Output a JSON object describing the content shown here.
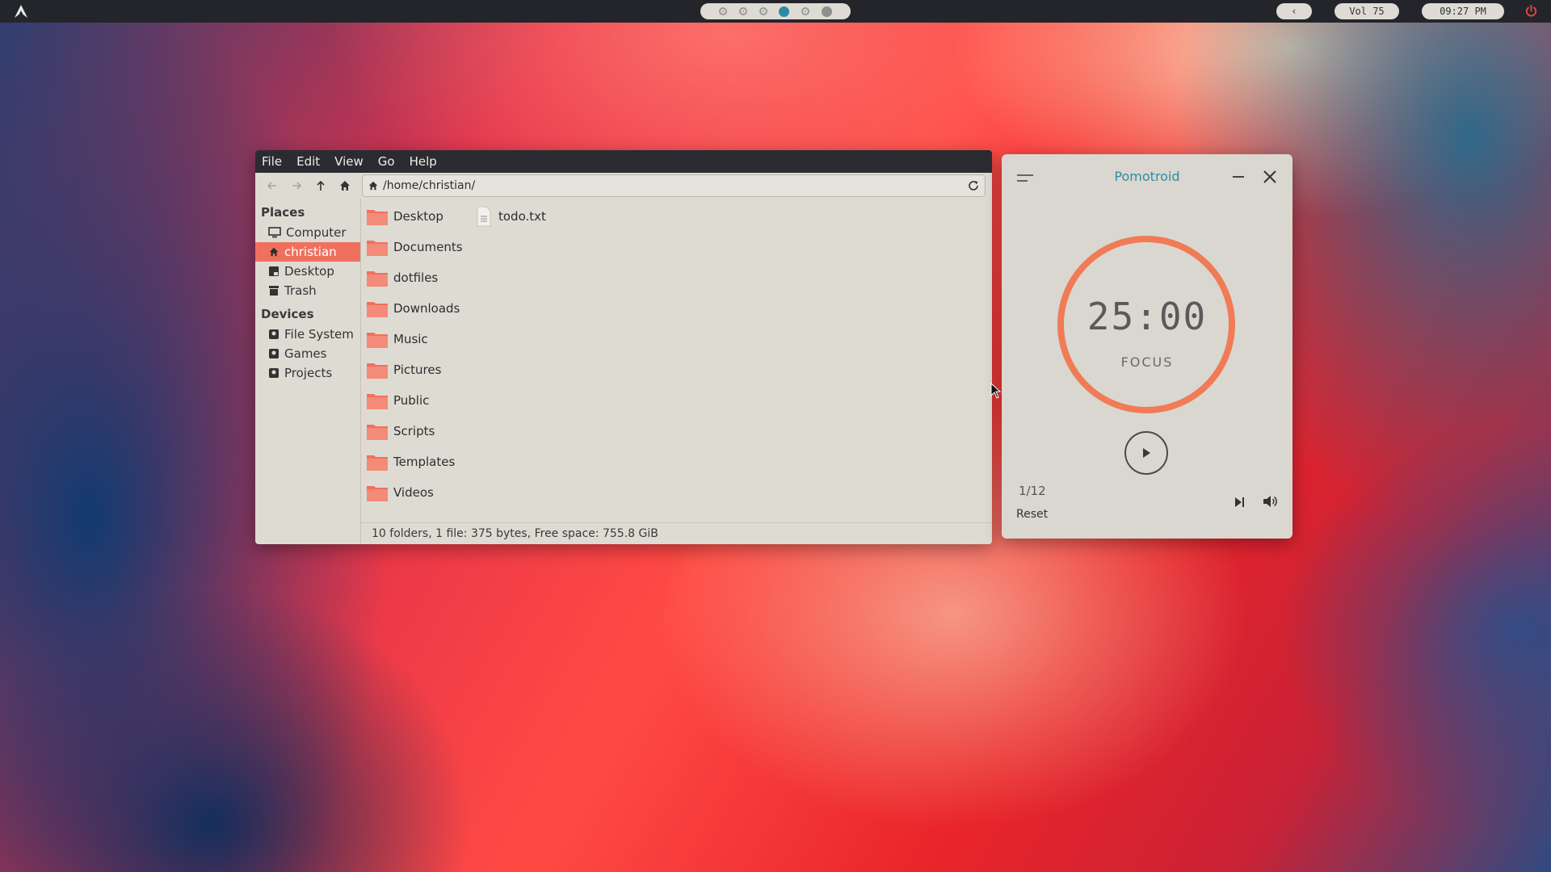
{
  "topbar": {
    "back_label": "‹",
    "volume": "Vol 75",
    "clock": "09:27 PM",
    "workspaces": {
      "count": 6,
      "active_index": 3
    }
  },
  "file_manager": {
    "menu": [
      "File",
      "Edit",
      "View",
      "Go",
      "Help"
    ],
    "path": "/home/christian/",
    "sidebar": {
      "places_heading": "Places",
      "places": [
        "Computer",
        "christian",
        "Desktop",
        "Trash"
      ],
      "active_place": "christian",
      "devices_heading": "Devices",
      "devices": [
        "File System",
        "Games",
        "Projects"
      ]
    },
    "folders": [
      "Desktop",
      "Documents",
      "dotfiles",
      "Downloads",
      "Music",
      "Pictures",
      "Public",
      "Scripts",
      "Templates",
      "Videos"
    ],
    "files": [
      "todo.txt"
    ],
    "status": "10 folders, 1 file: 375 bytes, Free space: 755.8 GiB"
  },
  "pomotroid": {
    "title": "Pomotroid",
    "time": "25:00",
    "phase": "FOCUS",
    "round": "1/12",
    "reset_label": "Reset",
    "progress": 1.0
  },
  "colors": {
    "accent_red": "#f0705e",
    "pomo_ring": "#f07b56",
    "pomo_title": "#2f8ea3",
    "workspace_active": "#2c8aa8"
  }
}
